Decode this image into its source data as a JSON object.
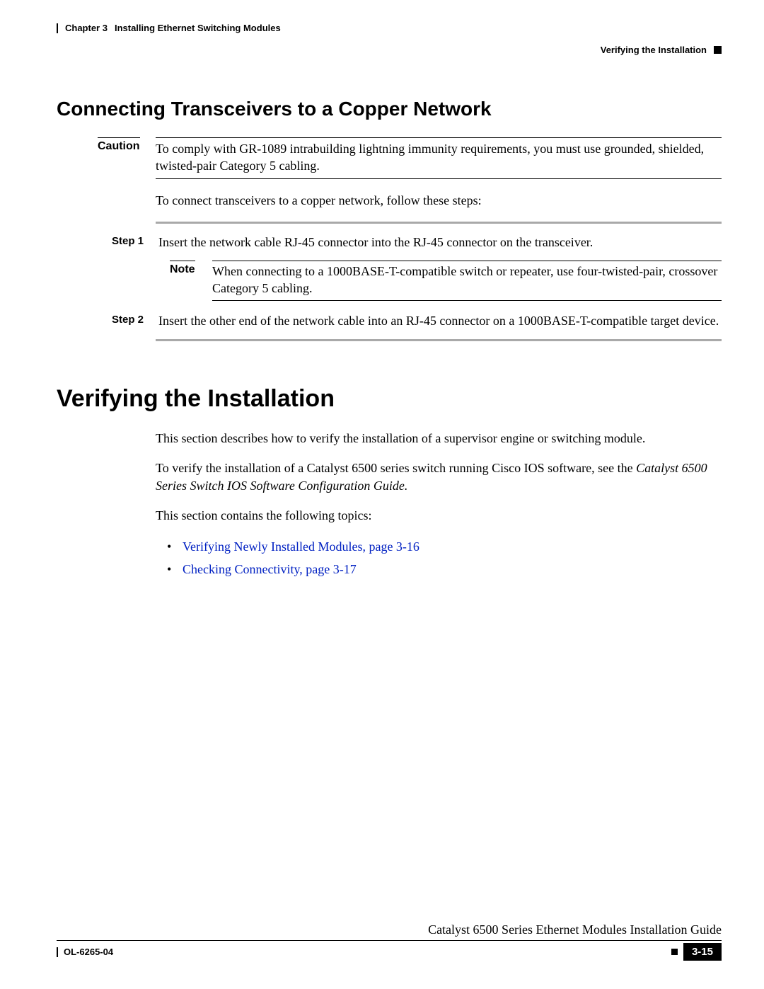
{
  "header": {
    "chapter_label": "Chapter 3",
    "chapter_title": "Installing Ethernet Switching Modules",
    "right": "Verifying the Installation"
  },
  "section1": {
    "heading": "Connecting Transceivers to a Copper Network",
    "caution_label": "Caution",
    "caution_text": "To comply with GR-1089 intrabuilding lightning immunity requirements, you must use grounded, shielded, twisted-pair Category 5 cabling.",
    "intro": "To connect transceivers to a copper network, follow these steps:",
    "steps": [
      {
        "label": "Step 1",
        "text": "Insert the network cable RJ-45 connector into the RJ-45 connector on the transceiver."
      },
      {
        "label": "Step 2",
        "text": "Insert the other end of the network cable into an RJ-45 connector on a 1000BASE-T-compatible target device."
      }
    ],
    "note_label": "Note",
    "note_text": "When connecting to a 1000BASE-T-compatible switch or repeater, use four-twisted-pair, crossover Category 5 cabling."
  },
  "section2": {
    "heading": "Verifying the Installation",
    "p1": "This section describes how to verify the installation of a supervisor engine or switching module.",
    "p2a": "To verify the installation of a Catalyst 6500 series switch running Cisco IOS software, see the ",
    "p2b_italic": "Catalyst 6500 Series Switch IOS Software Configuration Guide.",
    "p3": "This section contains the following topics:",
    "links": [
      "Verifying Newly Installed Modules, page 3-16",
      "Checking Connectivity, page 3-17"
    ]
  },
  "footer": {
    "guide": "Catalyst 6500 Series Ethernet Modules Installation Guide",
    "doc_id": "OL-6265-04",
    "page": "3-15"
  }
}
